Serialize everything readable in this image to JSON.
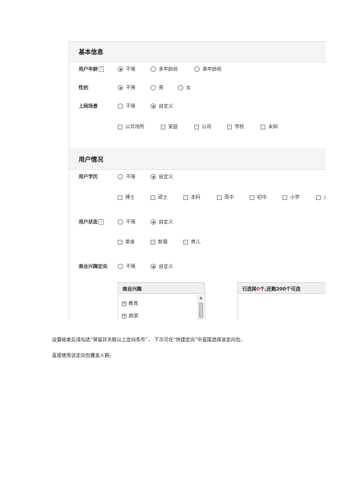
{
  "basic": {
    "title": "基本信息",
    "user_age": {
      "label": "用户年龄",
      "help": "?",
      "options": [
        "不限",
        "多年龄段",
        "单年龄段"
      ],
      "selected": "不限"
    },
    "gender": {
      "label": "性别",
      "options": [
        "不限",
        "男",
        "女"
      ],
      "selected": "不限"
    },
    "scene": {
      "label": "上网场景",
      "options": [
        "不限",
        "自定义"
      ],
      "selected": "自定义",
      "checkboxes": [
        "公共场所",
        "家庭",
        "公司",
        "学校",
        "未知"
      ]
    }
  },
  "user": {
    "title": "用户情况",
    "education": {
      "label": "用户学历",
      "options": [
        "不限",
        "自定义"
      ],
      "selected": "自定义",
      "checkboxes": [
        "博士",
        "硕士",
        "本科",
        "高中",
        "初中",
        "小学",
        "大"
      ]
    },
    "status": {
      "label": "用户状态",
      "help": "?",
      "options": [
        "不限",
        "自定义"
      ],
      "selected": "自定义",
      "checkboxes": [
        "单身",
        "新婚",
        "育儿"
      ]
    },
    "interest": {
      "label": "商业兴趣定向",
      "options": [
        "不限",
        "自定义"
      ],
      "selected": "自定义",
      "panel_title": "商业兴趣",
      "tree": [
        "教育",
        "旅游"
      ],
      "selected_prefix": "已选择",
      "selected_count": "0",
      "selected_suffix": "个,还剩200个可选"
    }
  },
  "caption": {
    "line1": "设置结束后请勾选“保留并关联以上定向条件”， 下次可在“快捷定向”中直接选择该定向包，",
    "line2": "直接使用该定向包覆盖人群。"
  }
}
